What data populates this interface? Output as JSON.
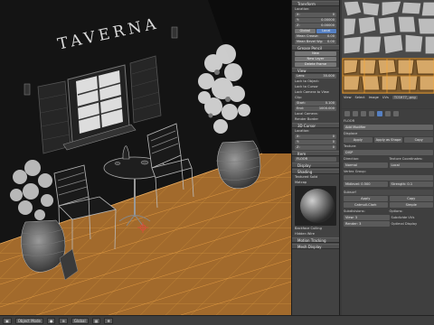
{
  "viewport": {
    "sign_text": "TAVERNA",
    "floor_color": "#a26a2c",
    "wall_color": "#121212",
    "grid_color": "#e0a040"
  },
  "npanel": {
    "transform_header": "Transform",
    "location_label": "Location:",
    "x": "0",
    "y": "0.00000",
    "z": "0.00000",
    "global_label": "Global",
    "local_label": "Local",
    "mean_crease": "Mean Crease:",
    "mean_crease_val": "0.00",
    "mean_bevel": "Mean Bevel Wg:",
    "mean_bevel_val": "0.00",
    "grease_header": "Grease Pencil",
    "new_label": "New",
    "new_layer_label": "New Layer",
    "delete_frame": "Delete Frame",
    "view_header": "View",
    "lens_label": "Lens:",
    "lens_val": "35.000",
    "lock_object": "Lock to Object:",
    "lock_cursor": "Lock to Cursor",
    "lock_camera": "Lock Camera to View",
    "clip_label": "Clip:",
    "clip_start": "Start:",
    "clip_start_val": "0.100",
    "clip_end": "End:",
    "clip_end_val": "1000.000",
    "local_camera": "Local Camera:",
    "render_border": "Render Border",
    "cursor_header": "3D Cursor",
    "cursor_location": "Location:",
    "cx": "0",
    "cy": "0",
    "cz": "0",
    "item_header": "Item",
    "item_name": "FLOOR",
    "display_header": "Display",
    "shading_header": "Shading",
    "textured_solid": "Textured Solid",
    "matcap": "Matcap",
    "backface": "Backface Culling",
    "hidden_wire": "Hidden Wire",
    "motion_tracking": "Motion Tracking",
    "mesh_display": "Mesh Display"
  },
  "uv_panel": {
    "menu_view": "View",
    "menu_select": "Select",
    "menu_image": "Image",
    "menu_uvs": "UVs",
    "image_name": "TCSH77_.png"
  },
  "properties": {
    "object_name": "FLOOR",
    "add_modifier": "Add Modifier",
    "modifier1_name": "Displace",
    "apply": "Apply",
    "apply_shape": "Apply as Shape Key",
    "copy": "Copy",
    "texture_label": "Texture:",
    "texture_name": "DISP",
    "direction_label": "Direction:",
    "direction_val": "Normal",
    "texcoords_label": "Texture Coordinates:",
    "texcoords_val": "Local",
    "vertex_group": "Vertex Group:",
    "midlevel_label": "Midlevel:",
    "midlevel_val": "0.500",
    "strength_label": "Strength:",
    "strength_val": "0.1",
    "modifier2_name": "Subsurf",
    "catmull": "Catmull-Clark",
    "simple": "Simple",
    "subdivisions_label": "Subdivisions:",
    "options_label": "Options:",
    "view_label": "View:",
    "view_val": "3",
    "render_label": "Render:",
    "render_val": "3",
    "subdiv_uvs": "Subdivide UVs",
    "optimal_display": "Optimal Display"
  },
  "header": {
    "mode": "Object Mode",
    "view_mode": "Global"
  }
}
